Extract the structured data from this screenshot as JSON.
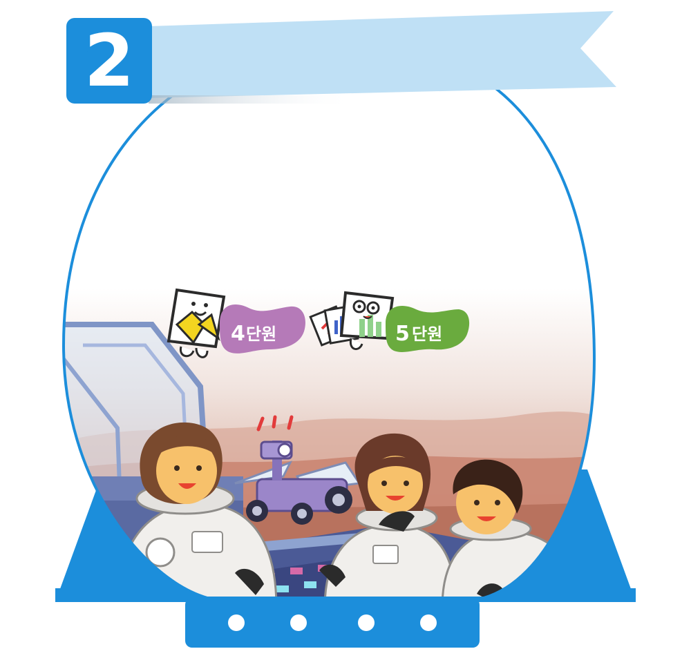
{
  "chapter": {
    "number": "2",
    "title": ""
  },
  "units": [
    {
      "number": "4",
      "suffix": "단원",
      "color": "#b57ab8"
    },
    {
      "number": "5",
      "suffix": "단원",
      "color": "#6aab3e"
    }
  ],
  "colors": {
    "primary_blue": "#1c8edb",
    "banner_light": "#bfe0f5",
    "sky_top": "#ffffff",
    "sky_bottom": "#e9d3cc",
    "mars_ground": "#c98a78"
  },
  "base": {
    "dots": 4
  }
}
